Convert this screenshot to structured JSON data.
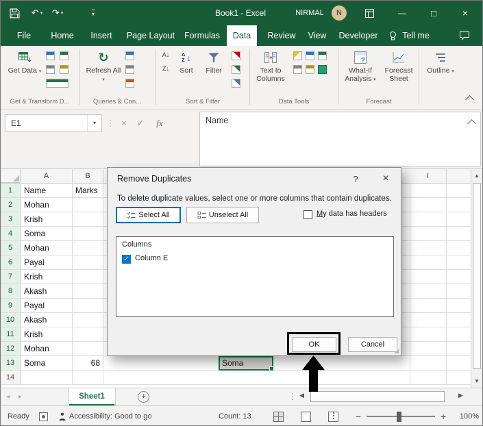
{
  "icons": {
    "dropdown": "▾",
    "undo": "↶",
    "redo": "↷",
    "refresh": "↻",
    "close": "×",
    "check": "✓",
    "dots_v": "⋮",
    "help": "?",
    "left": "◀",
    "right": "▶",
    "up": "▲",
    "down": "▼",
    "tab_left": "◂",
    "tab_right": "▸",
    "grip": "◢",
    "minimize": "—",
    "maximize": "□",
    "minus": "−",
    "plus": "+",
    "arrow_down": "↓",
    "letter_a": "A",
    "letter_z": "Z",
    "sort_az": "A↓",
    "sort_za": "Z↓",
    "fx": "fx"
  },
  "titlebar": {
    "title": "Book1 - Excel",
    "user_name": "NIRMAL",
    "avatar_initial": "N"
  },
  "tabs": {
    "file": "File",
    "home": "Home",
    "insert": "Insert",
    "page_layout": "Page Layout",
    "formulas": "Formulas",
    "data": "Data",
    "review": "Review",
    "view": "View",
    "developer": "Developer",
    "tell_me": "Tell me"
  },
  "ribbon": {
    "get_data": "Get Data",
    "refresh_all": "Refresh All",
    "sort": "Sort",
    "filter": "Filter",
    "text_to_columns": "Text to Columns",
    "what_if": "What-If Analysis",
    "forecast_sheet": "Forecast Sheet",
    "outline": "Outline",
    "group_get_transform": "Get & Transform D...",
    "group_queries": "Queries & Con...",
    "group_sort_filter": "Sort & Filter",
    "group_data_tools": "Data Tools",
    "group_forecast": "Forecast"
  },
  "formula_bar": {
    "name_box": "E1",
    "content": "Name"
  },
  "grid": {
    "col_a": "A",
    "col_b": "B",
    "col_i": "I",
    "rows": [
      {
        "n": "1",
        "a": "Name",
        "b": "Marks"
      },
      {
        "n": "2",
        "a": "Mohan",
        "b": ""
      },
      {
        "n": "3",
        "a": "Krish",
        "b": ""
      },
      {
        "n": "4",
        "a": "Soma",
        "b": ""
      },
      {
        "n": "5",
        "a": "Mohan",
        "b": ""
      },
      {
        "n": "6",
        "a": "Payal",
        "b": ""
      },
      {
        "n": "7",
        "a": "Krish",
        "b": ""
      },
      {
        "n": "8",
        "a": "Akash",
        "b": ""
      },
      {
        "n": "9",
        "a": "Payal",
        "b": ""
      },
      {
        "n": "10",
        "a": "Akash",
        "b": ""
      },
      {
        "n": "11",
        "a": "Krish",
        "b": ""
      },
      {
        "n": "12",
        "a": "Mohan",
        "b": ""
      },
      {
        "n": "13",
        "a": "Soma",
        "b": "68"
      },
      {
        "n": "14",
        "a": "",
        "b": ""
      }
    ],
    "selected_cell_value": "Soma"
  },
  "dialog": {
    "title": "Remove Duplicates",
    "description": "To delete duplicate values, select one or more columns that contain duplicates.",
    "select_all": "Select All",
    "unselect_all": "Unselect All",
    "headers_accel": "M",
    "headers_rest": "y data has headers",
    "columns_label": "Columns",
    "column_item": "Column E",
    "ok": "OK",
    "cancel": "Cancel"
  },
  "sheet_bar": {
    "sheet1": "Sheet1"
  },
  "status_bar": {
    "ready": "Ready",
    "accessibility": "Accessibility: Good to go",
    "count": "Count: 13",
    "zoom_level": "100%"
  }
}
